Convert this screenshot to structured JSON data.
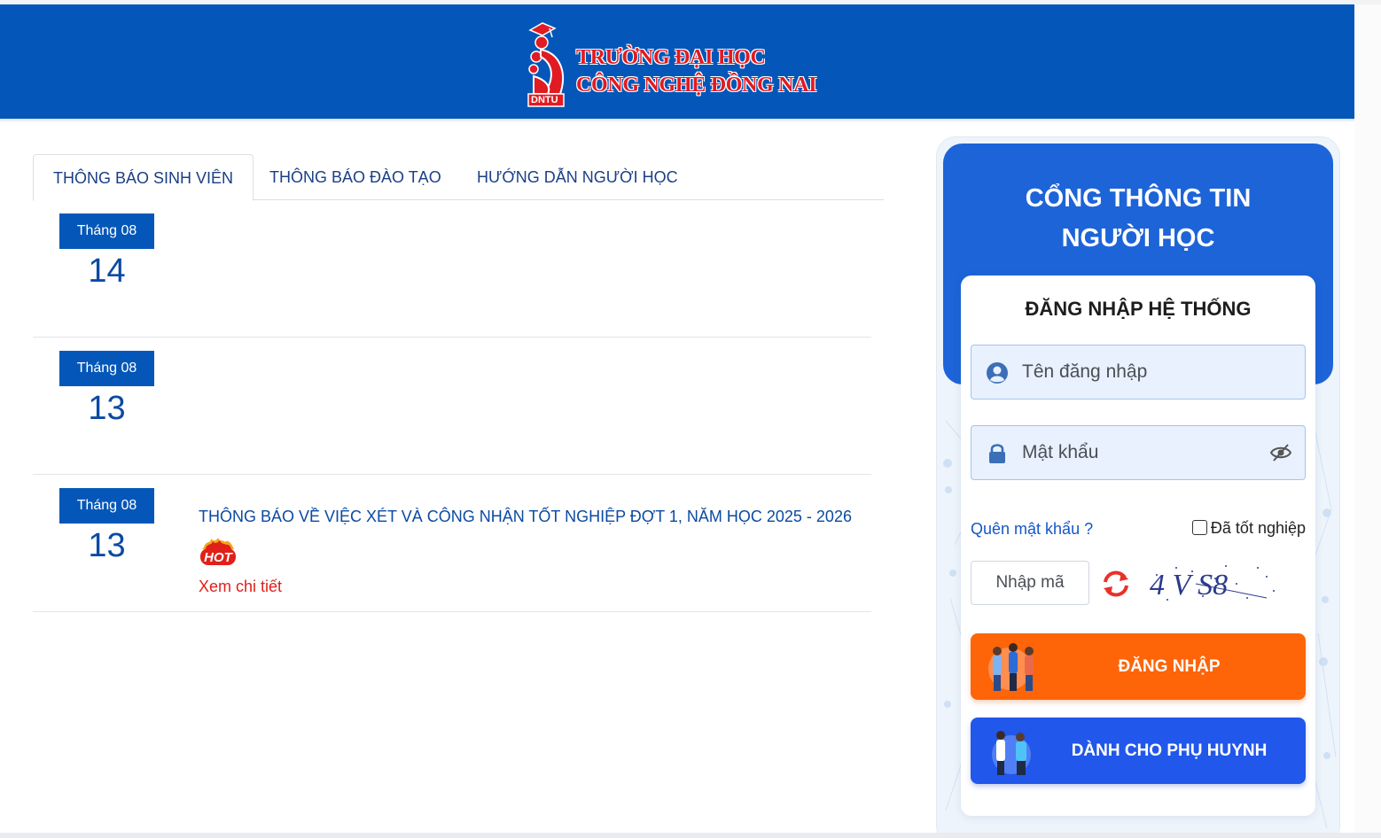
{
  "header": {
    "school_name_line1": "TRƯỜNG ĐẠI HỌC",
    "school_name_line2": "CÔNG NGHỆ ĐỒNG NAI",
    "logo_abbr": "DNTU"
  },
  "tabs": [
    {
      "label": "THÔNG BÁO SINH VIÊN",
      "active": true
    },
    {
      "label": "THÔNG BÁO ĐÀO TẠO",
      "active": false
    },
    {
      "label": "HƯỚNG DẪN NGƯỜI HỌC",
      "active": false
    }
  ],
  "news": [
    {
      "month": "Tháng 08",
      "day": "14",
      "title": "",
      "hot": false,
      "detail": ""
    },
    {
      "month": "Tháng 08",
      "day": "13",
      "title": "",
      "hot": false,
      "detail": ""
    },
    {
      "month": "Tháng 08",
      "day": "13",
      "title": "THÔNG BÁO VỀ VIỆC XÉT VÀ CÔNG NHẬN TỐT NGHIỆP ĐỢT 1, NĂM HỌC 2025 - 2026",
      "hot": true,
      "hot_text": "HOT",
      "detail": "Xem chi tiết"
    }
  ],
  "login": {
    "portal_title_line1": "CỔNG THÔNG TIN",
    "portal_title_line2": "NGƯỜI HỌC",
    "form_title": "ĐĂNG NHẬP HỆ THỐNG",
    "username_placeholder": "Tên đăng nhập",
    "password_placeholder": "Mật khẩu",
    "forgot_password": "Quên mật khẩu ?",
    "graduated_label": "Đã tốt nghiệp",
    "captcha_placeholder": "Nhập mã",
    "captcha_text": "4 V S8",
    "login_button": "ĐĂNG NHẬP",
    "parent_button": "DÀNH CHO PHỤ HUYNH"
  },
  "colors": {
    "primary_blue": "#0457b8",
    "panel_blue": "#1d64d8",
    "login_orange": "#fe6408",
    "parent_blue": "#2157ea",
    "hot_red": "#e0201a"
  }
}
